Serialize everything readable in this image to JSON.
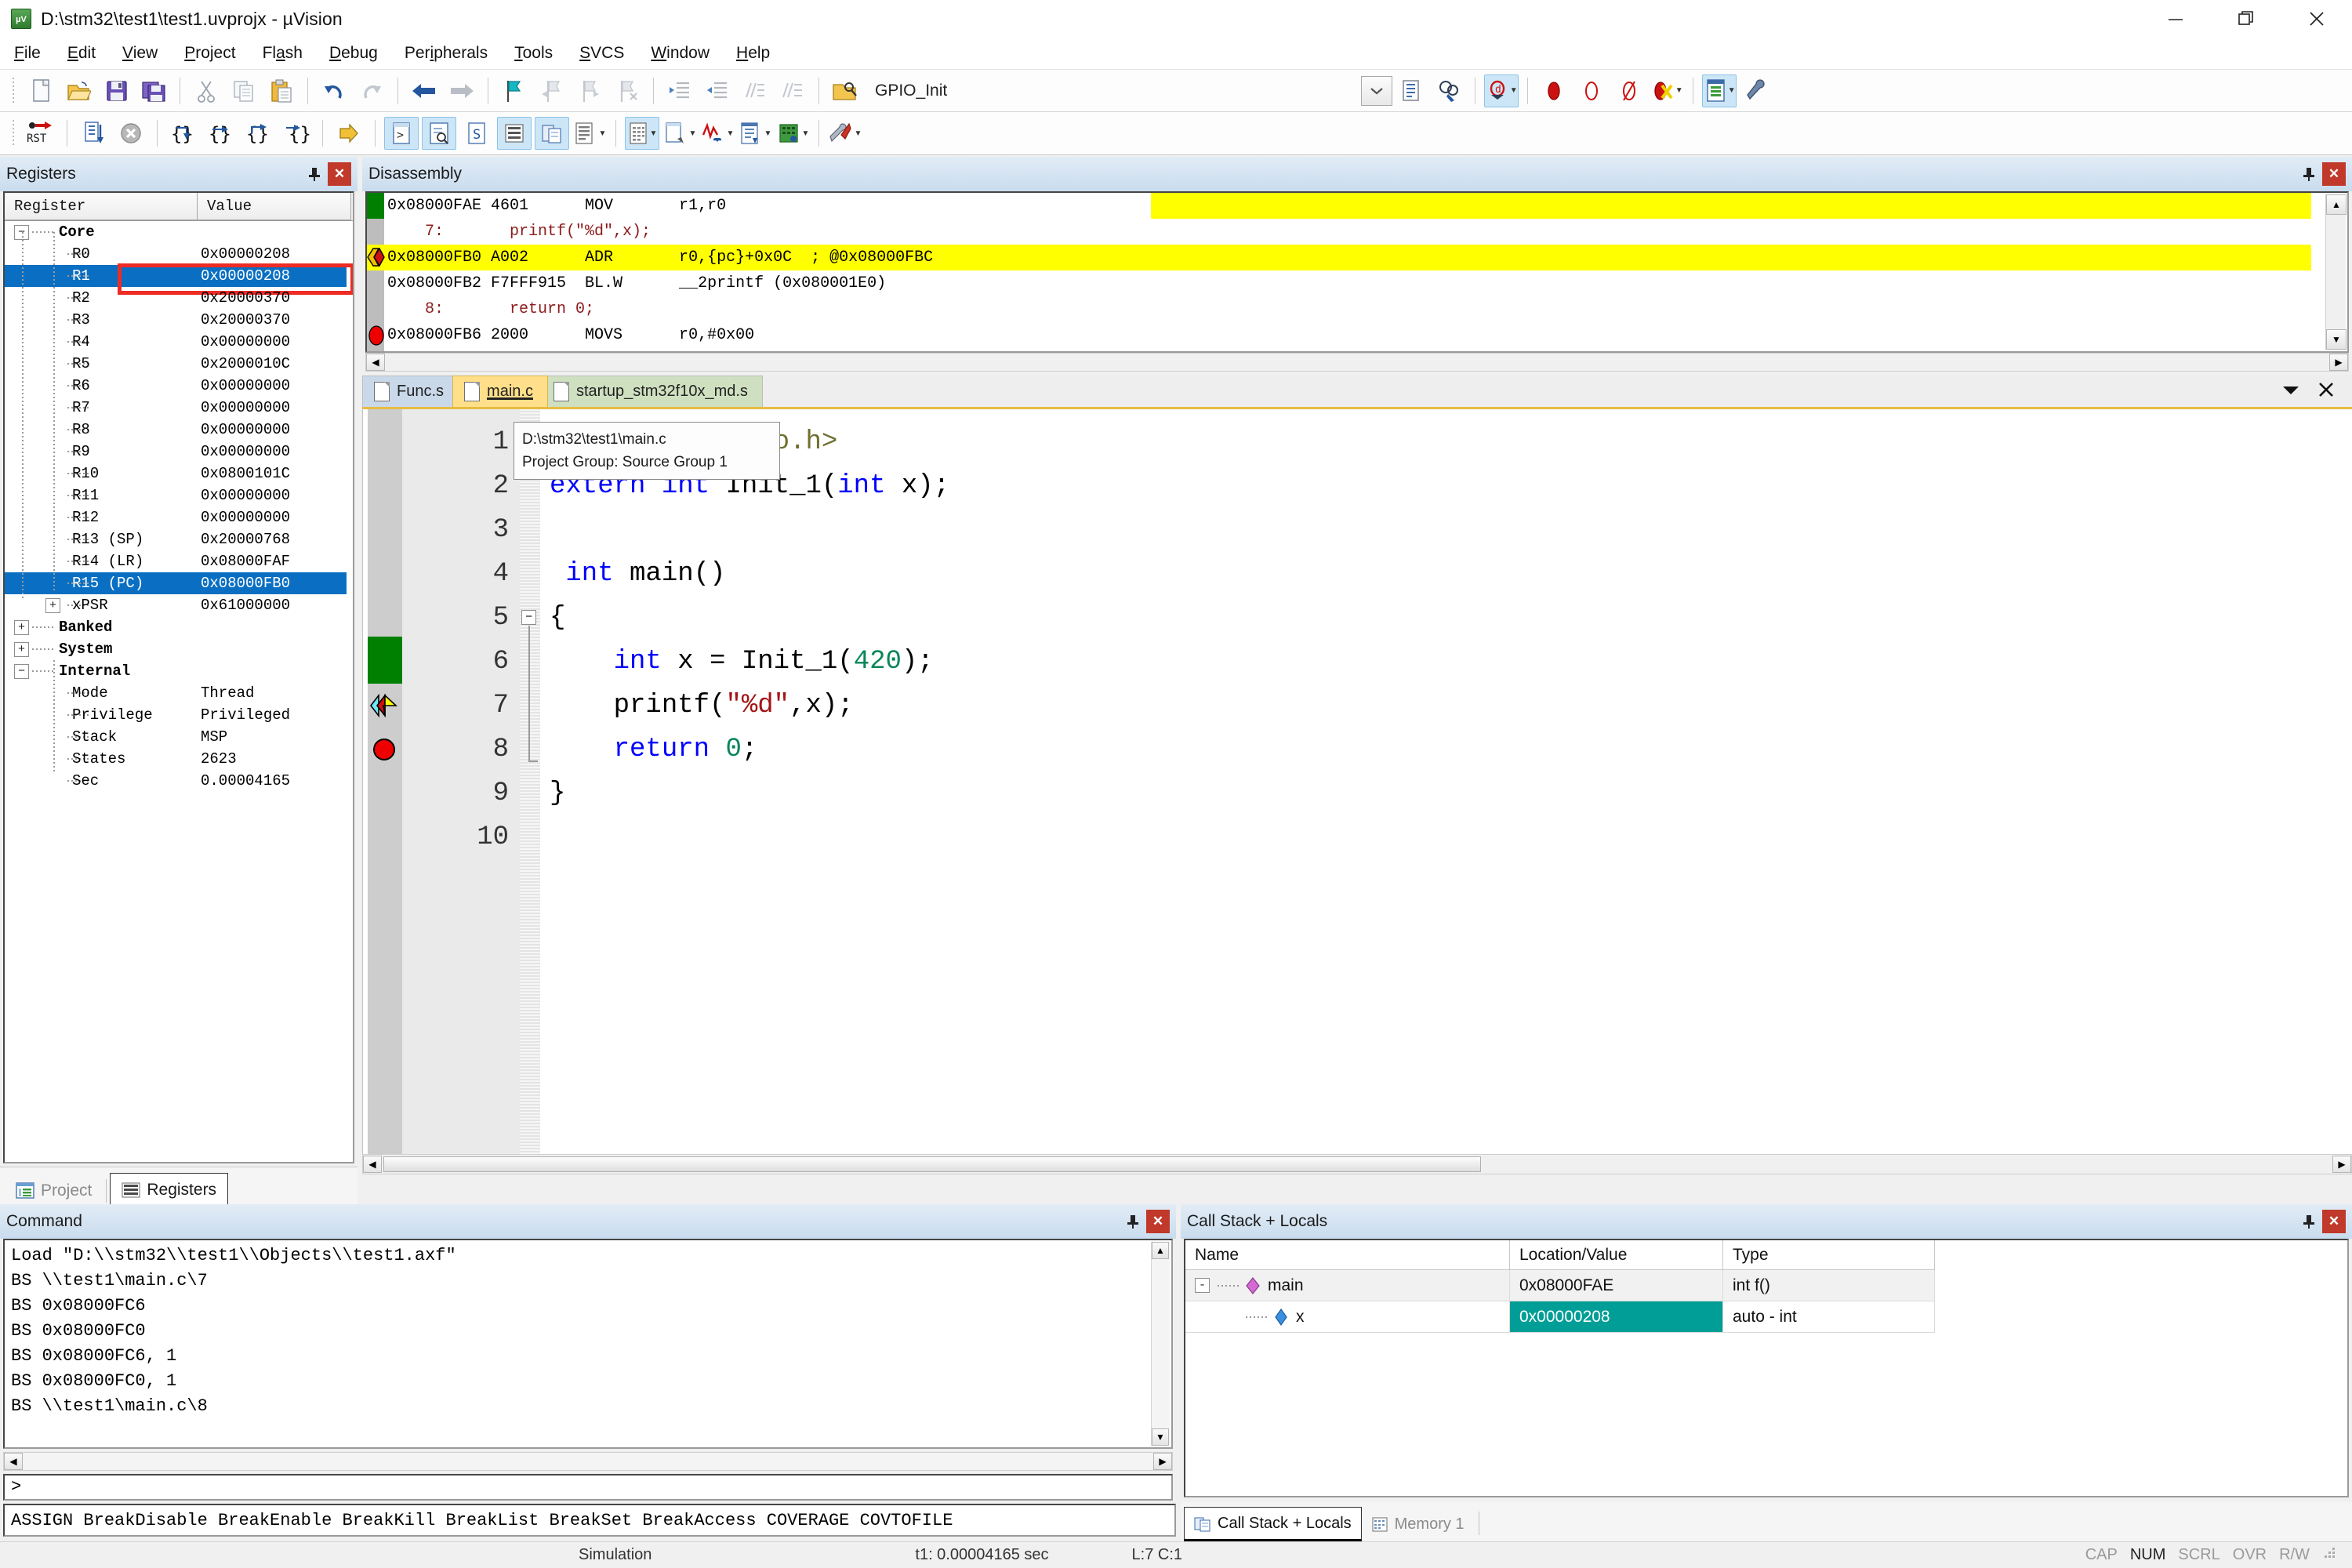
{
  "window": {
    "title": "D:\\stm32\\test1\\test1.uvprojx - µVision",
    "app_icon": "uvision-icon",
    "minimize": "—",
    "maximize": "❐",
    "close": "✕"
  },
  "menu": {
    "items": [
      {
        "label": "File",
        "accel": "F"
      },
      {
        "label": "Edit",
        "accel": "E"
      },
      {
        "label": "View",
        "accel": "V"
      },
      {
        "label": "Project",
        "accel": "P"
      },
      {
        "label": "Flash",
        "accel": "a"
      },
      {
        "label": "Debug",
        "accel": "D"
      },
      {
        "label": "Peripherals",
        "accel": "i"
      },
      {
        "label": "Tools",
        "accel": "T"
      },
      {
        "label": "SVCS",
        "accel": "S"
      },
      {
        "label": "Window",
        "accel": "W"
      },
      {
        "label": "Help",
        "accel": "H"
      }
    ]
  },
  "toolbar_main": {
    "function_combo_value": "GPIO_Init",
    "buttons": [
      "new-file-icon",
      "open-file-icon",
      "save-icon",
      "save-all-icon",
      "cut-icon",
      "copy-icon",
      "paste-icon",
      "undo-icon",
      "redo-icon",
      "navigate-back-icon",
      "navigate-forward-icon",
      "bookmark-toggle-icon",
      "bookmark-prev-icon",
      "bookmark-next-icon",
      "bookmark-clear-icon",
      "indent-icon",
      "outdent-icon",
      "comment-icon",
      "uncomment-icon",
      "find-in-files-icon"
    ],
    "right_buttons": [
      "combo-dropdown-icon",
      "text-browse-icon",
      "find-icon",
      "debug-session-icon",
      "insert-breakpoint-icon",
      "disable-breakpoint-icon",
      "disable-all-breakpoints-icon",
      "kill-all-breakpoints-icon",
      "manage-components-icon",
      "configure-target-icon"
    ]
  },
  "toolbar_debug": {
    "buttons": [
      "reset-cpu-icon",
      "run-icon",
      "stop-icon",
      "step-into-icon",
      "step-over-icon",
      "step-out-icon",
      "run-to-cursor-icon",
      "show-next-statement-icon",
      "command-window-icon",
      "disassembly-window-icon",
      "symbols-window-icon",
      "registers-window-icon",
      "call-stack-window-icon",
      "watch-window-icon",
      "memory-window-icon",
      "serial-window-icon",
      "analysis-window-icon",
      "trace-window-icon",
      "system-viewer-icon",
      "toolbox-icon"
    ]
  },
  "registers_panel": {
    "caption": "Registers",
    "pin_icon": "pin-icon",
    "close_icon": "close-icon",
    "columns": [
      "Register",
      "Value"
    ],
    "groups": [
      {
        "name": "Core",
        "expanded": true,
        "rows": [
          {
            "name": "R0",
            "value": "0x00000208",
            "selected": false
          },
          {
            "name": "R1",
            "value": "0x00000208",
            "selected": true,
            "outlined": true
          },
          {
            "name": "R2",
            "value": "0x20000370",
            "selected": false
          },
          {
            "name": "R3",
            "value": "0x20000370",
            "selected": false
          },
          {
            "name": "R4",
            "value": "0x00000000",
            "selected": false
          },
          {
            "name": "R5",
            "value": "0x2000010C",
            "selected": false
          },
          {
            "name": "R6",
            "value": "0x00000000",
            "selected": false
          },
          {
            "name": "R7",
            "value": "0x00000000",
            "selected": false
          },
          {
            "name": "R8",
            "value": "0x00000000",
            "selected": false
          },
          {
            "name": "R9",
            "value": "0x00000000",
            "selected": false
          },
          {
            "name": "R10",
            "value": "0x0800101C",
            "selected": false
          },
          {
            "name": "R11",
            "value": "0x00000000",
            "selected": false
          },
          {
            "name": "R12",
            "value": "0x00000000",
            "selected": false
          },
          {
            "name": "R13 (SP)",
            "value": "0x20000768",
            "selected": false
          },
          {
            "name": "R14 (LR)",
            "value": "0x08000FAF",
            "selected": false
          },
          {
            "name": "R15 (PC)",
            "value": "0x08000FB0",
            "selected": true
          },
          {
            "name": "xPSR",
            "value": "0x61000000",
            "selected": false,
            "expander": "+"
          }
        ]
      },
      {
        "name": "Banked",
        "expanded": false,
        "rows": []
      },
      {
        "name": "System",
        "expanded": false,
        "rows": []
      },
      {
        "name": "Internal",
        "expanded": true,
        "rows": [
          {
            "name": "Mode",
            "value": "Thread",
            "selected": false
          },
          {
            "name": "Privilege",
            "value": "Privileged",
            "selected": false
          },
          {
            "name": "Stack",
            "value": "MSP",
            "selected": false
          },
          {
            "name": "States",
            "value": "2623",
            "selected": false
          },
          {
            "name": "Sec",
            "value": "0.00004165",
            "selected": false
          }
        ]
      }
    ],
    "bottom_tabs": [
      {
        "label": "Project",
        "icon": "project-icon",
        "active": false
      },
      {
        "label": "Registers",
        "icon": "registers-icon",
        "active": true
      }
    ]
  },
  "disassembly_panel": {
    "caption": "Disassembly",
    "pin_icon": "pin-icon",
    "close_icon": "close-icon",
    "lines": [
      {
        "kind": "asm",
        "text": "0x08000FAE 4601      MOV       r1,r0",
        "marker": "green-bar",
        "highlight_right": true
      },
      {
        "kind": "src",
        "text": "    7:       printf(\"%d\",x);",
        "marker": "none"
      },
      {
        "kind": "asm",
        "text": "0x08000FB0 A002      ADR       r0,{pc}+0x0C  ; @0x08000FBC",
        "marker": "current-pc-arrow",
        "highlight": true
      },
      {
        "kind": "asm",
        "text": "0x08000FB2 F7FFF915  BL.W      __2printf (0x080001E0)",
        "marker": "none"
      },
      {
        "kind": "src",
        "text": "    8:       return 0;",
        "marker": "none"
      },
      {
        "kind": "asm",
        "text": "0x08000FB6 2000      MOVS      r0,#0x00",
        "marker": "breakpoint-red"
      }
    ]
  },
  "editor": {
    "tabs": [
      {
        "label": "Func.s",
        "active": false,
        "style": "blue"
      },
      {
        "label": "main.c",
        "active": true,
        "style": "amber"
      },
      {
        "label": "startup_stm32f10x_md.s",
        "active": false,
        "style": "green"
      }
    ],
    "tools": [
      {
        "icon": "chevron-down-icon"
      },
      {
        "icon": "close-icon"
      }
    ],
    "tooltip": {
      "line1": "D:\\stm32\\test1\\main.c",
      "line2": "Project Group: Source Group 1"
    },
    "lines": [
      {
        "n": "1",
        "tokens": [
          {
            "t": "#include <stdio.h>",
            "c": "pp"
          }
        ],
        "marker": "none"
      },
      {
        "n": "2",
        "tokens": [
          {
            "t": "extern",
            "c": "kw"
          },
          {
            "t": " ",
            "c": "id"
          },
          {
            "t": "int",
            "c": "kw"
          },
          {
            "t": " Init_1(",
            "c": "id"
          },
          {
            "t": "int",
            "c": "kw"
          },
          {
            "t": " x);",
            "c": "id"
          }
        ],
        "marker": "none"
      },
      {
        "n": "3",
        "tokens": [],
        "marker": "none"
      },
      {
        "n": "4",
        "tokens": [
          {
            "t": " ",
            "c": "id"
          },
          {
            "t": "int",
            "c": "kw"
          },
          {
            "t": " main()",
            "c": "id"
          }
        ],
        "marker": "none"
      },
      {
        "n": "5",
        "tokens": [
          {
            "t": "{",
            "c": "id"
          }
        ],
        "marker": "none",
        "fold": "-"
      },
      {
        "n": "6",
        "tokens": [
          {
            "t": "    ",
            "c": "id"
          },
          {
            "t": "int",
            "c": "kw"
          },
          {
            "t": " x = Init_1(",
            "c": "id"
          },
          {
            "t": "420",
            "c": "num"
          },
          {
            "t": ");",
            "c": "id"
          }
        ],
        "marker": "green-bar"
      },
      {
        "n": "7",
        "tokens": [
          {
            "t": "    printf(",
            "c": "id"
          },
          {
            "t": "\"%d\"",
            "c": "str"
          },
          {
            "t": ",x);",
            "c": "id"
          }
        ],
        "marker": "current-line-arrow"
      },
      {
        "n": "8",
        "tokens": [
          {
            "t": "    ",
            "c": "id"
          },
          {
            "t": "return",
            "c": "kw"
          },
          {
            "t": " ",
            "c": "id"
          },
          {
            "t": "0",
            "c": "num"
          },
          {
            "t": ";",
            "c": "id"
          }
        ],
        "marker": "breakpoint-red"
      },
      {
        "n": "9",
        "tokens": [
          {
            "t": "}",
            "c": "id"
          }
        ],
        "marker": "none"
      },
      {
        "n": "10",
        "tokens": [],
        "marker": "none"
      }
    ]
  },
  "command_panel": {
    "caption": "Command",
    "pin_icon": "pin-icon",
    "close_icon": "close-icon",
    "lines": [
      "Load \"D:\\\\stm32\\\\test1\\\\Objects\\\\test1.axf\"",
      "BS \\\\test1\\main.c\\7",
      "BS 0x08000FC6",
      "BS 0x08000FC0",
      "BS 0x08000FC6, 1",
      "BS 0x08000FC0, 1",
      "BS \\\\test1\\main.c\\8"
    ],
    "prompt": ">",
    "input_value": "",
    "hints": "ASSIGN BreakDisable BreakEnable BreakKill BreakList BreakSet BreakAccess COVERAGE COVTOFILE"
  },
  "call_stack_panel": {
    "caption": "Call Stack + Locals",
    "pin_icon": "pin-icon",
    "close_icon": "close-icon",
    "columns": [
      "Name",
      "Location/Value",
      "Type"
    ],
    "rows": [
      {
        "indent": 0,
        "expander": "-",
        "icon": "function-diamond-icon",
        "name": "main",
        "location": "0x08000FAE",
        "type": "int f()",
        "highlight": false
      },
      {
        "indent": 1,
        "expander": "",
        "icon": "variable-diamond-icon",
        "name": "x",
        "location": "0x00000208",
        "type": "auto - int",
        "highlight": true
      }
    ],
    "bottom_tabs": [
      {
        "label": "Call Stack + Locals",
        "icon": "call-stack-icon",
        "active": true
      },
      {
        "label": "Memory 1",
        "icon": "memory-icon",
        "active": false
      }
    ]
  },
  "status_bar": {
    "mode": "Simulation",
    "time": "t1: 0.00004165 sec",
    "caret": "L:7 C:1",
    "indicators": [
      "CAP",
      "NUM",
      "SCRL",
      "OVR",
      "R/W"
    ],
    "active_indicator": "NUM"
  },
  "colors": {
    "accent_blue": "#0a6fc2",
    "highlight_yellow": "#ffff00",
    "breakpoint_red": "#ee0000",
    "outline_red": "#ee2b24",
    "teal_value": "#009e96",
    "green_bar": "#008000",
    "tab_amber": "#ffdf8a"
  }
}
